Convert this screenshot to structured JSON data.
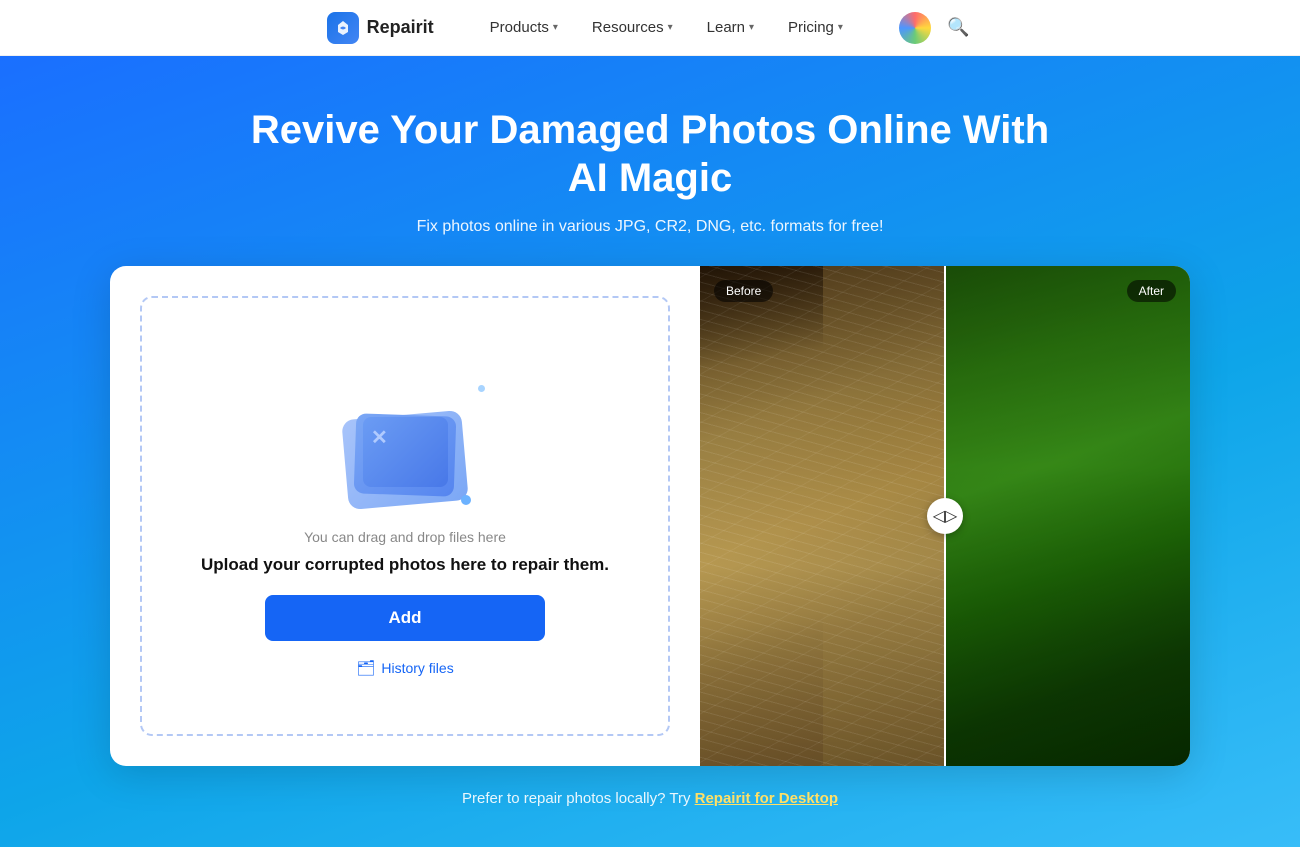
{
  "nav": {
    "logo_text": "Repairit",
    "items": [
      {
        "id": "products",
        "label": "Products",
        "has_dropdown": true
      },
      {
        "id": "resources",
        "label": "Resources",
        "has_dropdown": true
      },
      {
        "id": "learn",
        "label": "Learn",
        "has_dropdown": true
      },
      {
        "id": "pricing",
        "label": "Pricing",
        "has_dropdown": true
      }
    ]
  },
  "hero": {
    "title": "Revive Your Damaged Photos Online With AI Magic",
    "subtitle": "Fix photos online in various JPG, CR2, DNG, etc. formats for free!"
  },
  "upload": {
    "drag_text": "You can drag and drop files here",
    "main_text": "Upload your corrupted photos here to repair them.",
    "add_button": "Add",
    "history_label": "History files"
  },
  "compare": {
    "before_label": "Before",
    "after_label": "After"
  },
  "footer": {
    "text": "Prefer to repair photos locally? Try ",
    "link_text": "Repairit for Desktop"
  }
}
